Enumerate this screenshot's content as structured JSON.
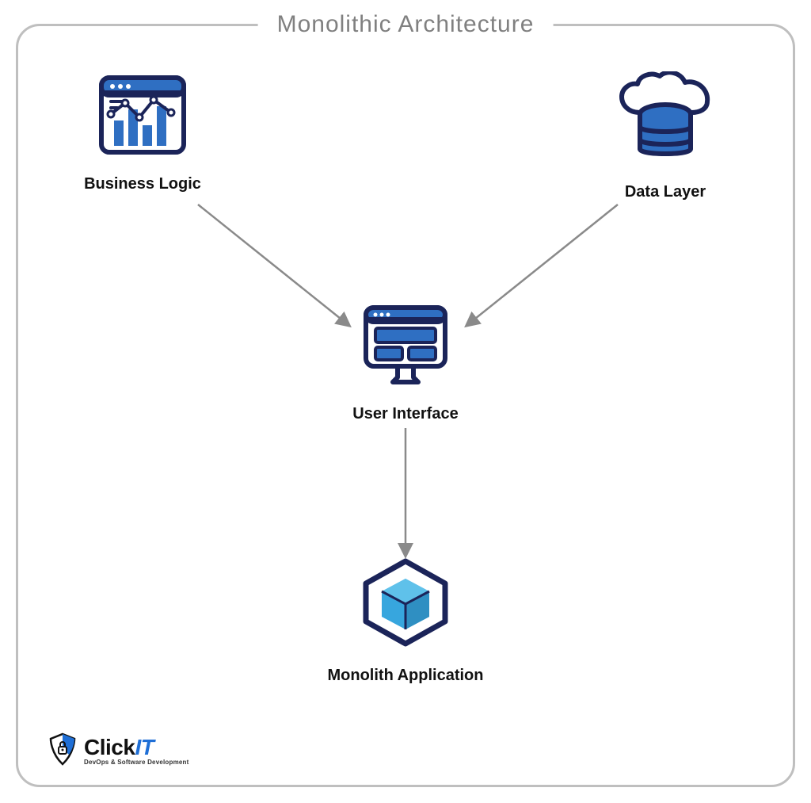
{
  "diagram": {
    "title": "Monolithic Architecture",
    "nodes": {
      "business_logic": {
        "label": "Business Logic",
        "icon": "analytics-dashboard-icon"
      },
      "data_layer": {
        "label": "Data Layer",
        "icon": "cloud-database-icon"
      },
      "user_interface": {
        "label": "User Interface",
        "icon": "monitor-ui-icon"
      },
      "monolith_app": {
        "label": "Monolith Application",
        "icon": "cube-package-icon"
      }
    },
    "edges": [
      {
        "from": "business_logic",
        "to": "user_interface"
      },
      {
        "from": "data_layer",
        "to": "user_interface"
      },
      {
        "from": "user_interface",
        "to": "monolith_app"
      }
    ]
  },
  "branding": {
    "logo_name": "ClickIT",
    "logo_name_part1": "Click",
    "logo_name_part2": "IT",
    "tagline": "DevOps & Software Development"
  },
  "colors": {
    "accent_primary": "#2f6fc2",
    "accent_dark": "#1b2459",
    "border_gray": "#bfbfbf",
    "arrow_gray": "#8a8a8a"
  }
}
